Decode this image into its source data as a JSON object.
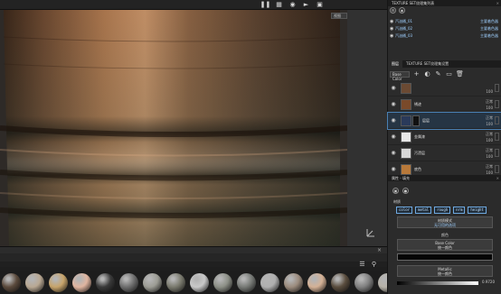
{
  "viewport": {
    "toolbar_icons": [
      "pause-icon",
      "grid-icon",
      "camera-icon",
      "render-icon",
      "snapshot-icon"
    ],
    "camera_select": "视图",
    "shelf_close": "×"
  },
  "spheres": [
    "#5b4a3c",
    "#b9a893",
    "#c7a46b",
    "#e0b5a0",
    "#3a3a3a",
    "#6e6e6e",
    "#9c9c94",
    "#7a7a6e",
    "#c9c9c9",
    "#8c8f86",
    "#777a76",
    "#b0b0b0",
    "#9b8b7d",
    "#d4b196",
    "#5a4d3e",
    "#808080",
    "#b6b2a8"
  ],
  "texture_sets": {
    "title": "TEXTURE SET纹理集列表",
    "items": [
      {
        "name": "汽油桶_01",
        "shader": "主要着色器"
      },
      {
        "name": "汽油桶_02",
        "shader": "主要着色器"
      },
      {
        "name": "汽油桶_03",
        "shader": "主要着色器"
      }
    ]
  },
  "layers_panel": {
    "tab_layers": "图层",
    "tab_settings": "TEXTURE SET纹理集设置",
    "channel": "Base Color",
    "layers": [
      {
        "name": "",
        "blend": "",
        "opacity": "100",
        "thumb": "#6b4a33"
      },
      {
        "name": "锈迹",
        "blend": "正常",
        "opacity": "100",
        "thumb": "#7a4a2a"
      },
      {
        "name": "层层",
        "blend": "正常",
        "opacity": "100",
        "thumb": "#2a3a5a",
        "selected": true
      },
      {
        "name": "金属漆",
        "blend": "正常",
        "opacity": "100",
        "thumb": "#e8e8e8"
      },
      {
        "name": "污渍层",
        "blend": "正常",
        "opacity": "100",
        "thumb": "#d8d8d8"
      },
      {
        "name": "底色",
        "blend": "正常",
        "opacity": "100",
        "thumb": "#b8793a"
      }
    ]
  },
  "properties": {
    "title": "属性 - 填充",
    "material_label": "材质",
    "chips": [
      "color",
      "metal",
      "rough",
      "nrm",
      "height"
    ],
    "blend_mode": "材质模式",
    "blend_mode_sub": "无可用的选项",
    "color_section": "颜色",
    "base_color_label": "Base Color",
    "base_color_sub": "统一颜色",
    "base_color_value": "#050505",
    "metallic_label": "Metallic",
    "metallic_sub": "统一颜色",
    "metallic_value": "0.9720"
  }
}
